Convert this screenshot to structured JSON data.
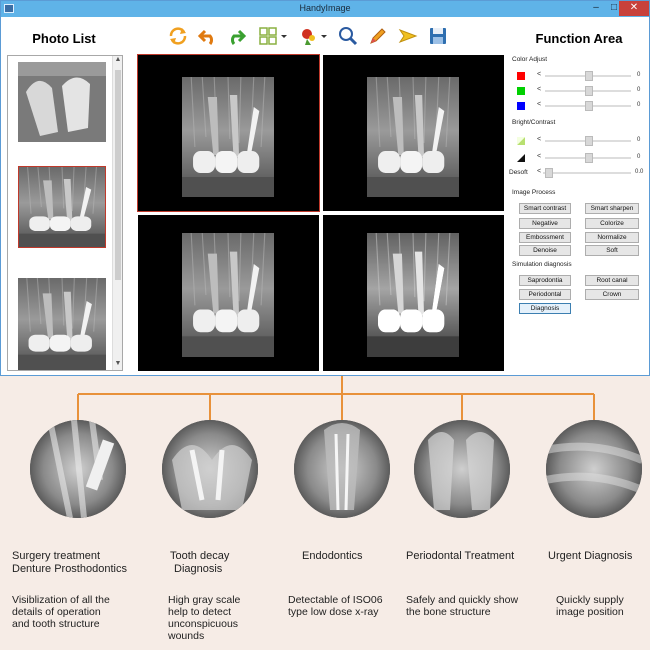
{
  "window": {
    "title": "HandyImage",
    "min_glyph": "–",
    "max_glyph": "□",
    "close_glyph": "✕"
  },
  "photo_list": {
    "title": "Photo List"
  },
  "function_area": {
    "title": "Function Area",
    "color_adjust": {
      "label": "Color Adjust",
      "rows": [
        {
          "color": "#ff0000",
          "value": "0"
        },
        {
          "color": "#00d000",
          "value": "0"
        },
        {
          "color": "#0000ff",
          "value": "0"
        }
      ]
    },
    "bright_contrast": {
      "label": "Bright/Contrast",
      "rows": [
        {
          "value": "0"
        },
        {
          "value": "0"
        }
      ]
    },
    "desoft": {
      "label": "Desoft",
      "value": "0.0"
    },
    "image_process": {
      "label": "Image Process",
      "buttons": [
        "Smart contrast",
        "Smart sharpen",
        "Negative",
        "Colorize",
        "Embossment",
        "Normalize",
        "Denoise",
        "Soft"
      ]
    },
    "simulation_diagnosis": {
      "label": "Simulation diagnosis",
      "buttons": [
        "Saprodontia",
        "Root canal",
        "Periodontal",
        "Crown",
        "Diagnosis"
      ]
    }
  },
  "slider_left_glyph": "<",
  "features": [
    {
      "title": [
        "Surgery treatment",
        "Denture Prosthodontics"
      ],
      "desc": [
        "Visiblization of all the",
        "details of operation",
        "and tooth structure"
      ]
    },
    {
      "title": [
        "Tooth decay",
        "Diagnosis"
      ],
      "desc": [
        "High gray scale",
        "help to detect",
        "unconspicuous",
        "wounds"
      ]
    },
    {
      "title": [
        "Endodontics"
      ],
      "desc": [
        "Detectable of ISO06",
        "type low dose x-ray"
      ]
    },
    {
      "title": [
        "Periodontal Treatment"
      ],
      "desc": [
        "Safely and quickly show",
        "the bone structure"
      ]
    },
    {
      "title": [
        "Urgent Diagnosis"
      ],
      "desc": [
        "Quickly supply",
        "image position"
      ]
    }
  ],
  "colors": {
    "accent_orange": "#e8913a",
    "titlebar": "#5fb3e8",
    "close": "#c8413b",
    "selection": "#c0392b"
  },
  "icons": [
    "refresh-icon",
    "undo-icon",
    "redo-icon",
    "layout-grid-icon",
    "marker-icon",
    "zoom-icon",
    "pencil-icon",
    "arrow-tag-icon",
    "save-icon"
  ]
}
